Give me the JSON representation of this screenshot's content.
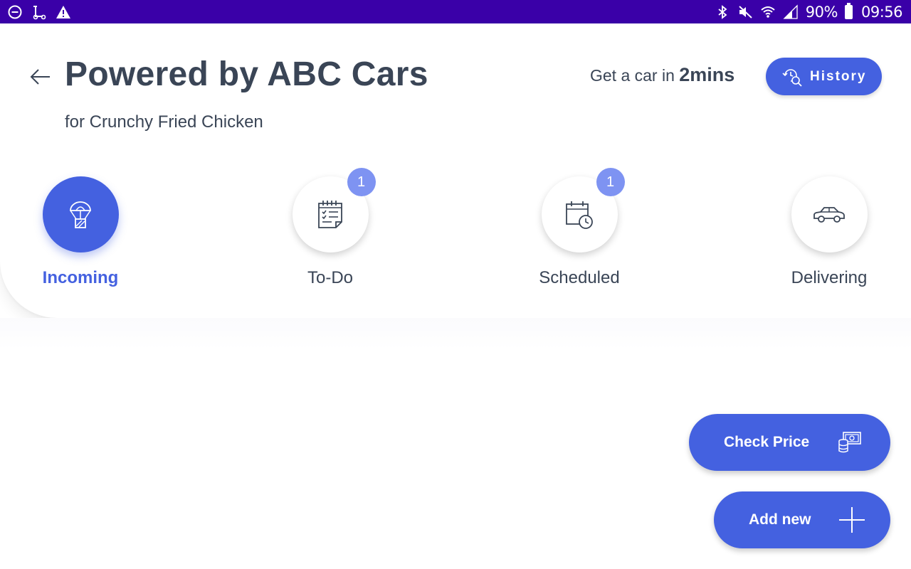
{
  "status_bar": {
    "battery_text": "90%",
    "time": "09:56",
    "left_icons": [
      "dnd-icon",
      "scooter-icon",
      "warning-icon"
    ],
    "right_icons": [
      "bluetooth-icon",
      "mute-icon",
      "wifi-icon",
      "signal-icon",
      "battery-icon"
    ],
    "background": "#3a00a8"
  },
  "header": {
    "title": "Powered by ABC Cars",
    "subtitle": "for Crunchy Fried Chicken",
    "eta_prefix": "Get a car in ",
    "eta_value": "2mins",
    "history_label": "History"
  },
  "tabs": [
    {
      "label": "Incoming",
      "icon": "parachute-icon",
      "active": true,
      "badge": ""
    },
    {
      "label": "To-Do",
      "icon": "checklist-icon",
      "active": false,
      "badge": "1"
    },
    {
      "label": "Scheduled",
      "icon": "calendar-clock-icon",
      "active": false,
      "badge": "1"
    },
    {
      "label": "Delivering",
      "icon": "car-icon",
      "active": false,
      "badge": ""
    }
  ],
  "actions": {
    "check_price_label": "Check Price",
    "add_new_label": "Add new"
  },
  "colors": {
    "accent": "#4461e0",
    "badge": "#7e93f2",
    "text": "#3a4556"
  }
}
